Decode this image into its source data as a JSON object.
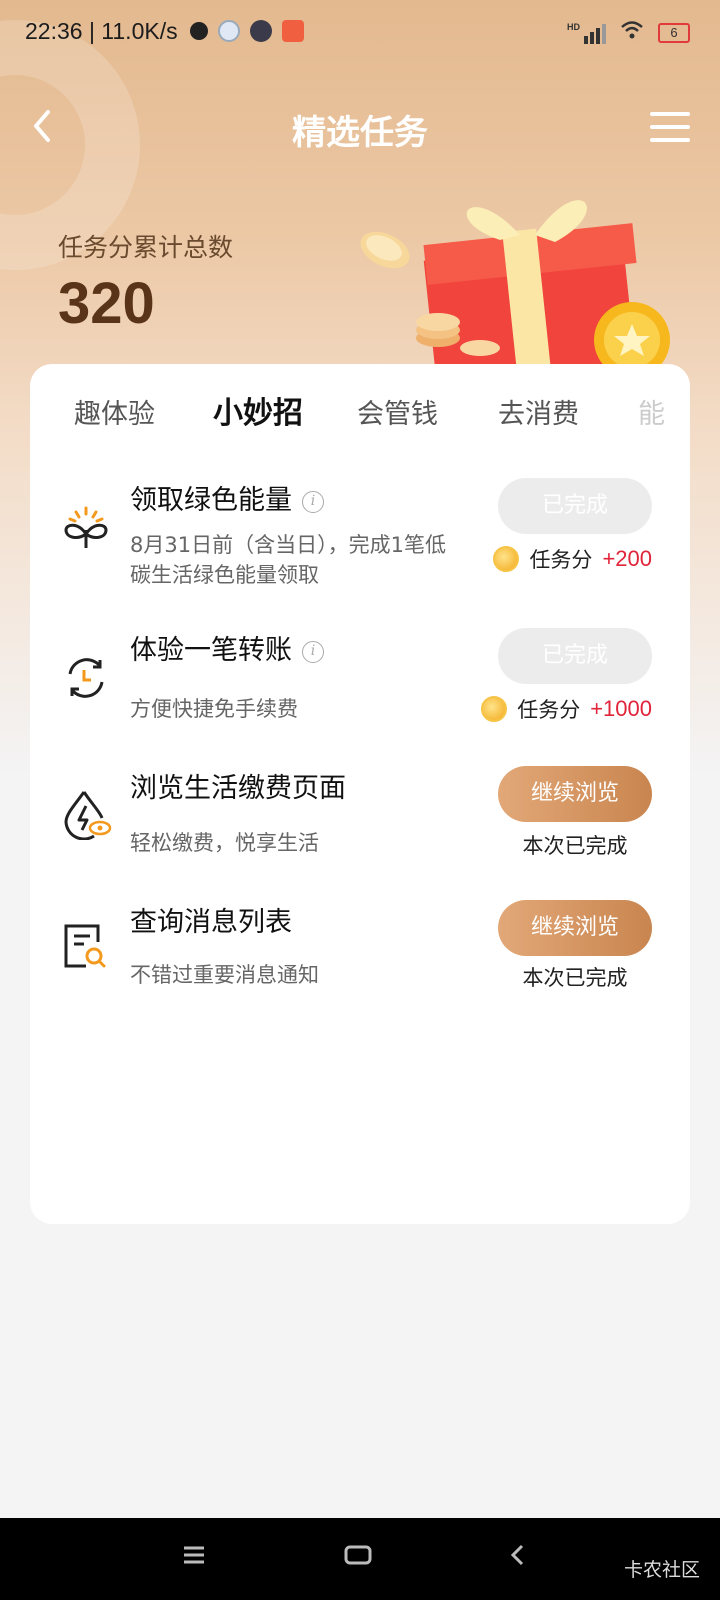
{
  "status_bar": {
    "time": "22:36 | 11.0K/s",
    "network": "HD",
    "battery": "6"
  },
  "header": {
    "title": "精选任务",
    "back_icon": "chevron-left-icon",
    "menu_icon": "hamburger-menu-icon"
  },
  "score": {
    "label": "任务分累计总数",
    "value": "320"
  },
  "tabs": [
    {
      "label": "趣体验"
    },
    {
      "label": "小妙招"
    },
    {
      "label": "会管钱"
    },
    {
      "label": "去消费"
    },
    {
      "label": "能"
    }
  ],
  "active_tab": "小妙招",
  "tasks": [
    {
      "title": "领取绿色能量",
      "desc": "8月31日前（含当日），完成1笔低碳生活绿色能量领取",
      "button": "已完成",
      "reward_label": "任务分",
      "reward_points": "+200",
      "icon": "sprout-icon"
    },
    {
      "title": "体验一笔转账",
      "desc": "方便快捷免手续费",
      "button": "已完成",
      "reward_label": "任务分",
      "reward_points": "+1000",
      "icon": "transfer-cycle-icon"
    },
    {
      "title": "浏览生活缴费页面",
      "desc": "轻松缴费，悦享生活",
      "button": "继续浏览",
      "status": "本次已完成",
      "icon": "utility-drop-icon"
    },
    {
      "title": "查询消息列表",
      "desc": "不错过重要消息通知",
      "button": "继续浏览",
      "status": "本次已完成",
      "icon": "document-search-icon"
    }
  ],
  "nav_bar": {
    "watermark": "卡农社区"
  },
  "colors": {
    "accent": "#c9854f",
    "points": "#e0243a",
    "score": "#5a3418"
  }
}
